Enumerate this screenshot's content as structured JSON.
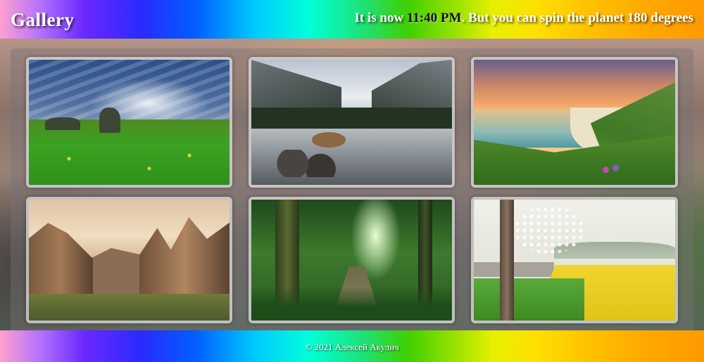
{
  "header": {
    "logo": "Gallery",
    "tagline_prefix": "It is now ",
    "time": "11:40 PM",
    "tagline_suffix": ". But you can spin the planet 180 degrees"
  },
  "gallery": {
    "photos": [
      {
        "subject": "meadow-with-rocks-and-dramatic-sky"
      },
      {
        "subject": "river-valley-with-cliffs"
      },
      {
        "subject": "coastal-bay-with-green-hills"
      },
      {
        "subject": "rocky-canyon-cliffs"
      },
      {
        "subject": "forest-wooden-boardwalk"
      },
      {
        "subject": "blossoming-trees-and-rapeseed-field"
      }
    ]
  },
  "footer": {
    "copyright": "© 2021 Алексей Акулич"
  },
  "colors": {
    "header_text": "#ffffff",
    "time_text": "#111111"
  }
}
